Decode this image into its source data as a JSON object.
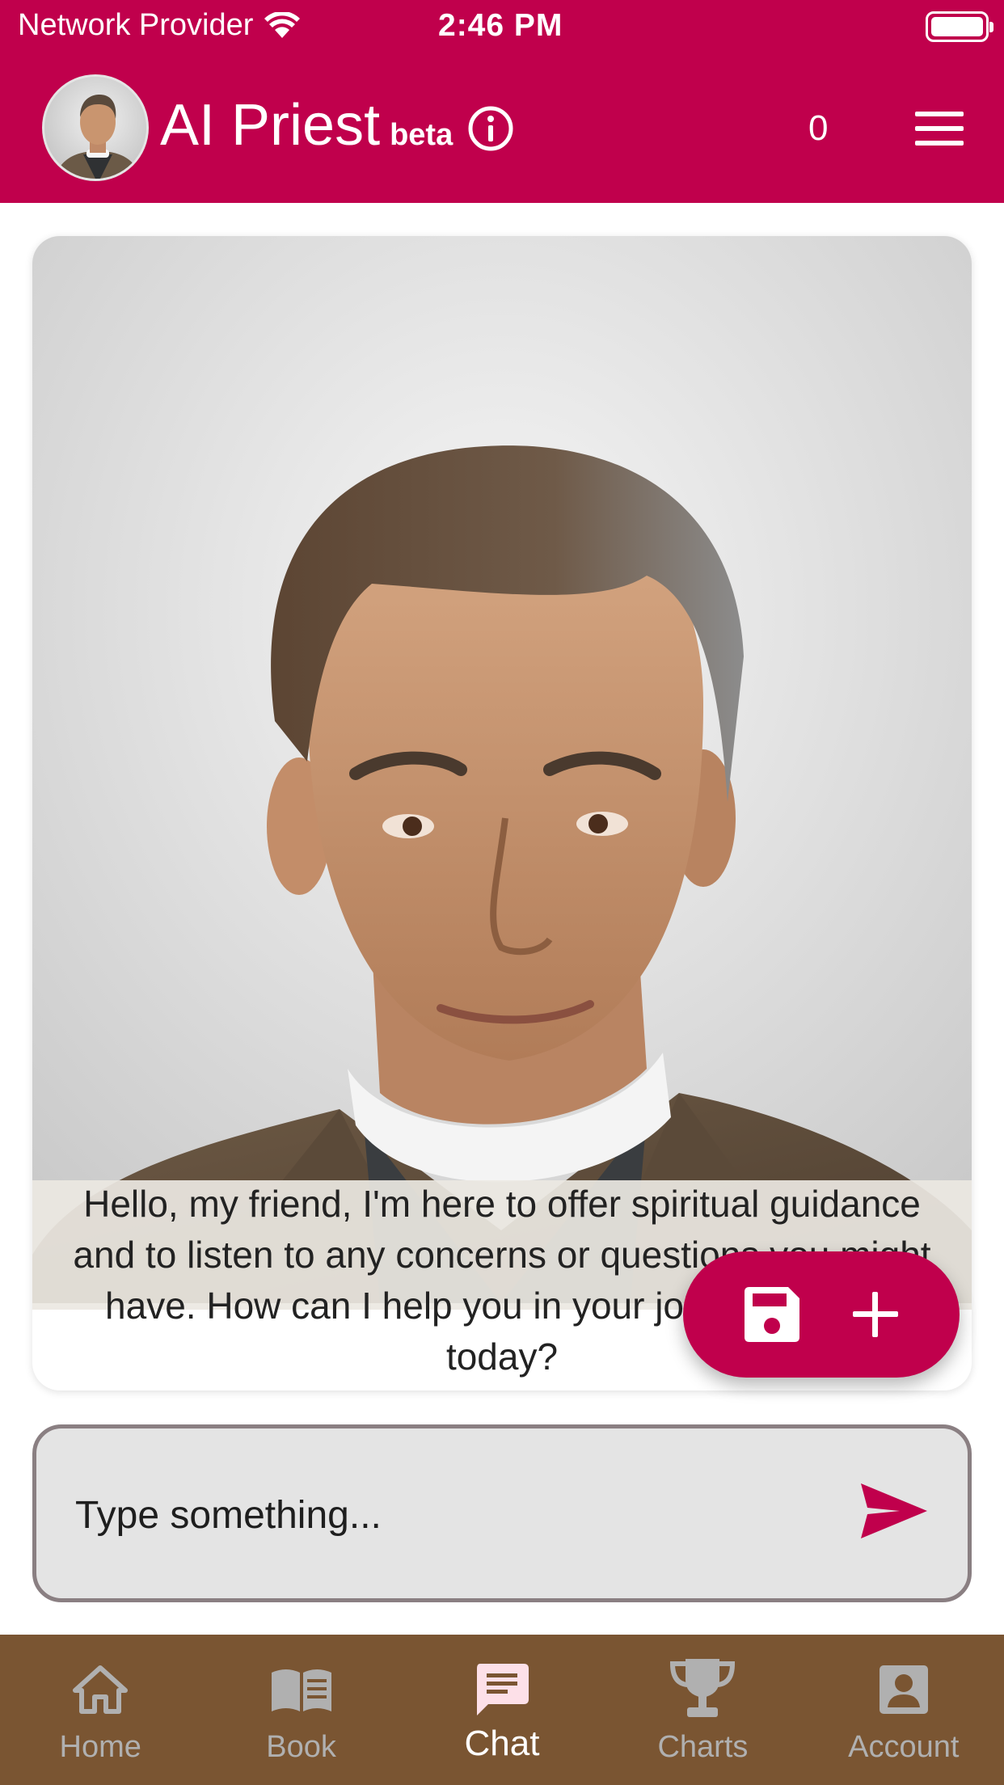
{
  "status_bar": {
    "carrier": "Network Provider",
    "time": "2:46 PM"
  },
  "header": {
    "title": "AI Priest",
    "badge": "beta",
    "counter": "0"
  },
  "chat": {
    "message": "Hello, my friend, I'm here to offer spiritual guidance and to listen to any concerns or questions you might have. How can I help you in your journey of faith today?"
  },
  "input": {
    "placeholder": "Type something..."
  },
  "nav": {
    "items": [
      {
        "label": "Home",
        "icon": "home-icon",
        "active": false
      },
      {
        "label": "Book",
        "icon": "book-icon",
        "active": false
      },
      {
        "label": "Chat",
        "icon": "chat-icon",
        "active": true
      },
      {
        "label": "Charts",
        "icon": "trophy-icon",
        "active": false
      },
      {
        "label": "Account",
        "icon": "account-icon",
        "active": false
      }
    ]
  },
  "colors": {
    "accent": "#c0004c",
    "nav_background": "#7a5532",
    "nav_inactive": "#b0b0b0",
    "nav_active": "#ffffff",
    "chat_icon_active": "#fde0e8"
  }
}
